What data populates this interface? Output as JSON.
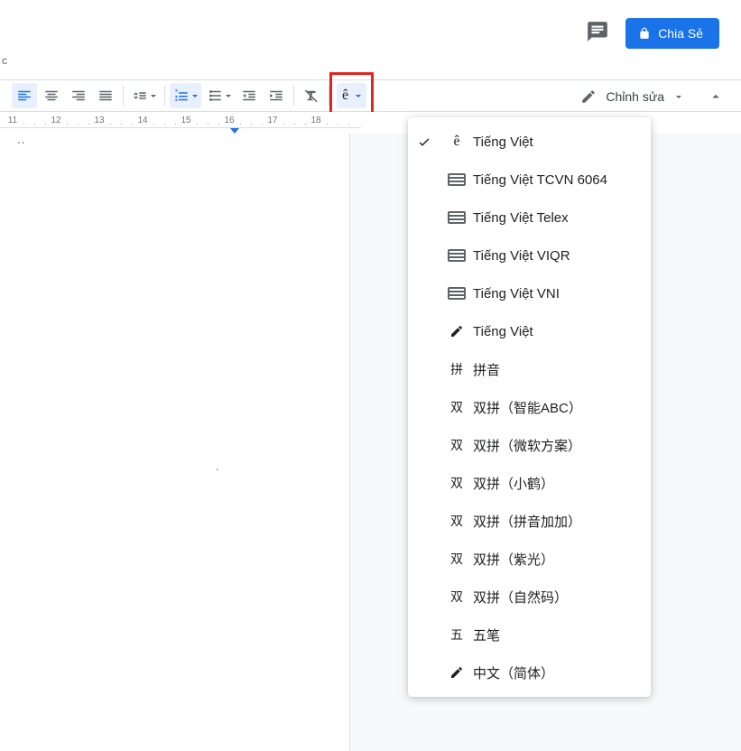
{
  "header": {
    "share_label": "Chia Sẻ"
  },
  "toolbar": {
    "edit_mode_label": "Chỉnh sửa",
    "ime_glyph": "ê"
  },
  "ruler": {
    "numbers": [
      11,
      12,
      13,
      14,
      15,
      16,
      17,
      18
    ]
  },
  "ime_menu": [
    {
      "checked": true,
      "icon": "glyph-e",
      "label": "Tiếng Việt"
    },
    {
      "checked": false,
      "icon": "keyboard",
      "label": "Tiếng Việt TCVN 6064"
    },
    {
      "checked": false,
      "icon": "keyboard",
      "label": "Tiếng Việt Telex"
    },
    {
      "checked": false,
      "icon": "keyboard",
      "label": "Tiếng Việt VIQR"
    },
    {
      "checked": false,
      "icon": "keyboard",
      "label": "Tiếng Việt VNI"
    },
    {
      "checked": false,
      "icon": "pencil",
      "label": "Tiếng Việt"
    },
    {
      "checked": false,
      "icon": "cn-pin",
      "label": "拼音"
    },
    {
      "checked": false,
      "icon": "cn-shuang",
      "label": "双拼（智能ABC）"
    },
    {
      "checked": false,
      "icon": "cn-shuang",
      "label": "双拼（微软方案）"
    },
    {
      "checked": false,
      "icon": "cn-shuang",
      "label": "双拼（小鹤）"
    },
    {
      "checked": false,
      "icon": "cn-shuang",
      "label": "双拼（拼音加加）"
    },
    {
      "checked": false,
      "icon": "cn-shuang",
      "label": "双拼（紫光）"
    },
    {
      "checked": false,
      "icon": "cn-shuang",
      "label": "双拼（自然码）"
    },
    {
      "checked": false,
      "icon": "cn-wu",
      "label": "五笔"
    },
    {
      "checked": false,
      "icon": "pencil",
      "label": "中文（简体）"
    }
  ],
  "ime_icon_glyphs": {
    "glyph-e": "ê",
    "cn-pin": "拼",
    "cn-shuang": "双",
    "cn-wu": "五"
  }
}
